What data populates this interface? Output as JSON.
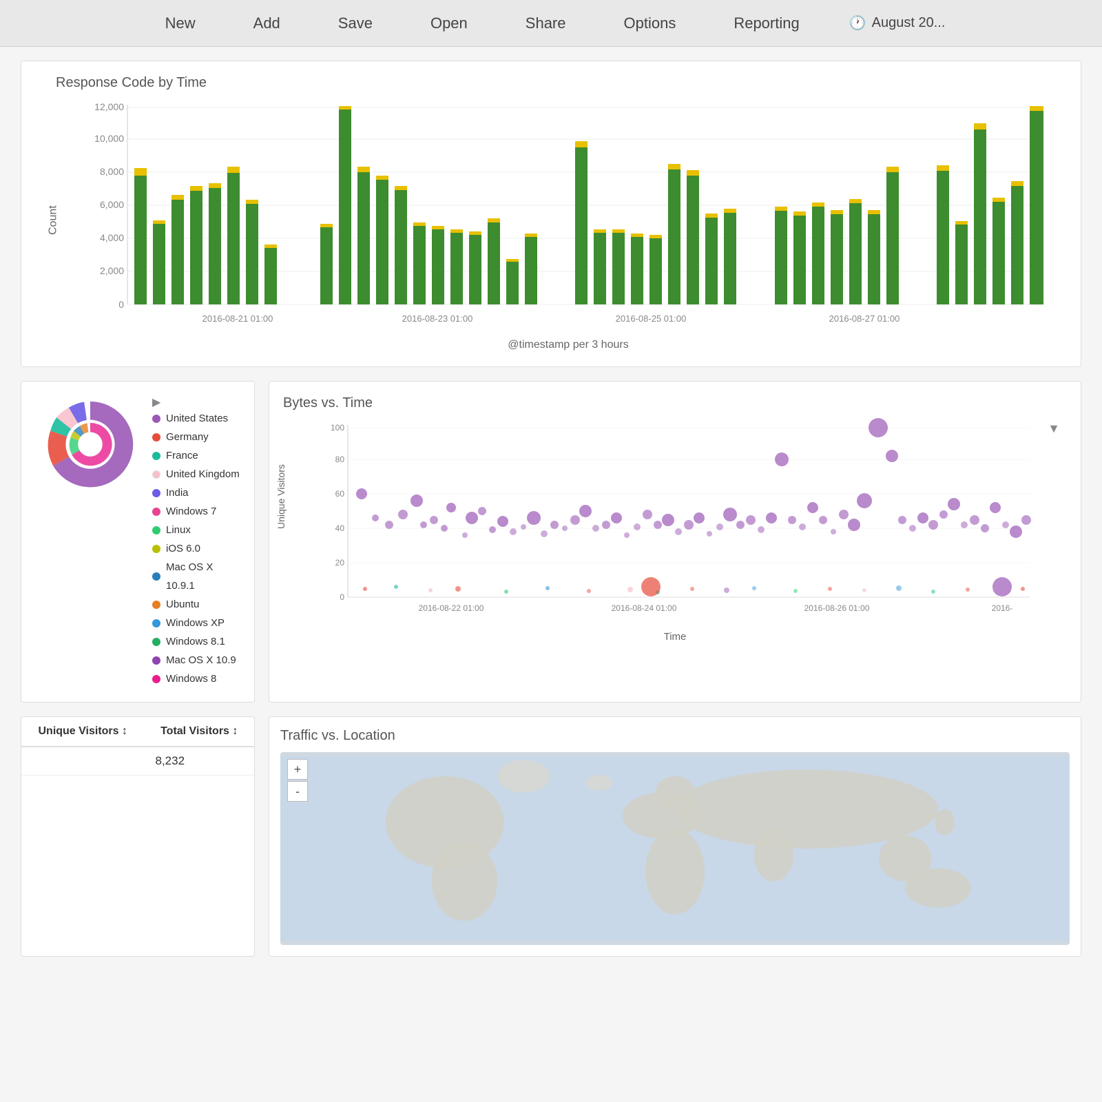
{
  "nav": {
    "items": [
      "New",
      "Add",
      "Save",
      "Open",
      "Share",
      "Options",
      "Reporting"
    ],
    "timestamp": "August 20..."
  },
  "barChart": {
    "title": "Response Code by Time",
    "yLabel": "Count",
    "xLabel": "@timestamp per 3 hours",
    "yMax": 12000,
    "yTicks": [
      0,
      2000,
      4000,
      6000,
      8000,
      10000,
      12000
    ],
    "xLabels": [
      "2016-08-21 01:00",
      "2016-08-23 01:00",
      "2016-08-25 01:00",
      "2016-08-27 01:00"
    ]
  },
  "donut": {
    "expand_label": "▶",
    "legend": [
      {
        "label": "United States",
        "color": "#9b59b6"
      },
      {
        "label": "Germany",
        "color": "#e74c3c"
      },
      {
        "label": "France",
        "color": "#1abc9c"
      },
      {
        "label": "United Kingdom",
        "color": "#f9c0cb"
      },
      {
        "label": "India",
        "color": "#6c5ce7"
      },
      {
        "label": "Windows 7",
        "color": "#e84393"
      },
      {
        "label": "Linux",
        "color": "#2ecc71"
      },
      {
        "label": "iOS 6.0",
        "color": "#b8c000"
      },
      {
        "label": "Mac OS X 10.9.1",
        "color": "#2980b9"
      },
      {
        "label": "Ubuntu",
        "color": "#e67e22"
      },
      {
        "label": "Windows XP",
        "color": "#3498db"
      },
      {
        "label": "Windows 8.1",
        "color": "#27ae60"
      },
      {
        "label": "Mac OS X 10.9",
        "color": "#8e44ad"
      },
      {
        "label": "Windows 8",
        "color": "#e91e8c"
      }
    ]
  },
  "scatterChart": {
    "title": "Bytes vs. Time",
    "yLabel": "Unique Visitors",
    "xLabel": "Time",
    "xLabels": [
      "2016-08-22 01:00",
      "2016-08-24 01:00",
      "2016-08-26 01:00",
      "2016-"
    ],
    "yTicks": [
      0,
      20,
      40,
      60,
      80,
      100
    ]
  },
  "tablePanel": {
    "columns": [
      "Unique Visitors ↕",
      "Total Visitors ↕"
    ],
    "rows": [
      {
        "unique": "",
        "total": "8,232"
      }
    ]
  },
  "mapPanel": {
    "title": "Traffic vs. Location",
    "zoomIn": "+",
    "zoomOut": "-"
  }
}
